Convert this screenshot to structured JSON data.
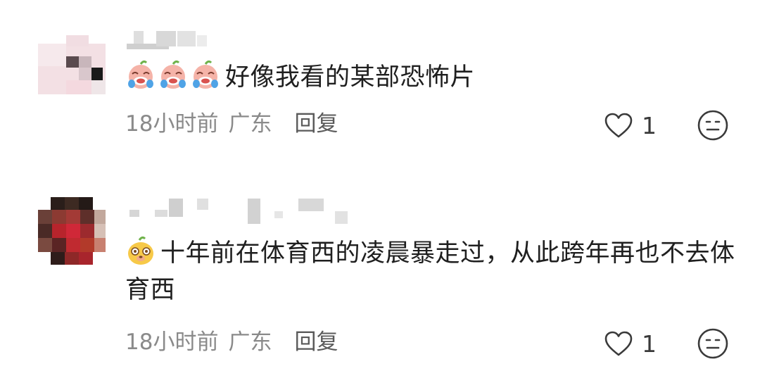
{
  "comments": [
    {
      "emojis": [
        "crying-face-emoji",
        "crying-face-emoji",
        "crying-face-emoji"
      ],
      "text": "好像我看的某部恐怖片",
      "time": "18小时前",
      "location": "广东",
      "reply_label": "回复",
      "like_count": "1"
    },
    {
      "emojis": [
        "yellow-dog-emoji"
      ],
      "text": "十年前在体育西的凌晨暴走过，从此跨年再也不去体育西",
      "time": "18小时前",
      "location": "广东",
      "reply_label": "回复",
      "like_count": "1"
    }
  ],
  "colors": {
    "text": "#1f1f1f",
    "meta": "#8a8a8a",
    "icon": "#3a3a3a"
  }
}
